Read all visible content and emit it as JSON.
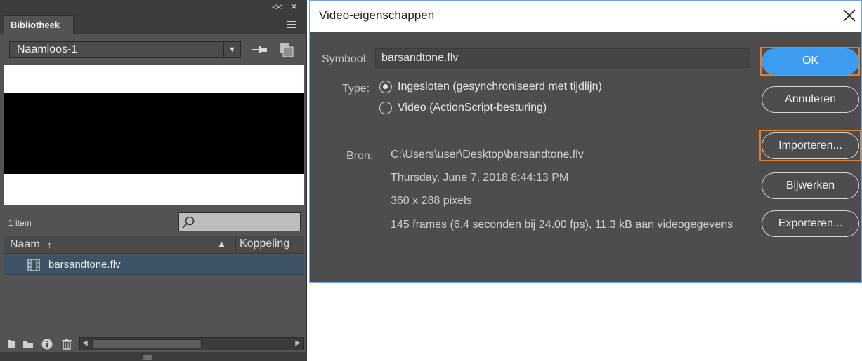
{
  "library": {
    "panel_controls": {
      "collapse": "<<",
      "close": "✕"
    },
    "tab_label": "Bibliotheek",
    "document_select": "Naamloos-1",
    "item_count": "1 item",
    "columns": {
      "name": "Naam",
      "linkage": "Koppeling"
    },
    "items": [
      {
        "name": "barsandtone.flv",
        "icon": "video-file-icon"
      }
    ],
    "preview_colors": {
      "background": "#ffffff",
      "band": "#000000"
    }
  },
  "dialog": {
    "title": "Video-eigenschappen",
    "symbol_label": "Symbool:",
    "symbol_value": "barsandtone.flv",
    "type_label": "Type:",
    "type_options": [
      {
        "label": "Ingesloten (gesynchroniseerd met tijdlijn)",
        "selected": true
      },
      {
        "label": "Video (ActionScript-besturing)",
        "selected": false
      }
    ],
    "source_label": "Bron:",
    "source_lines": [
      "C:\\Users\\user\\Desktop\\barsandtone.flv",
      "Thursday, June 7, 2018  8:44:13 PM",
      "360 x 288 pixels",
      "145 frames (6.4 seconden bij 24.00 fps), 11.3 kB aan videogegevens"
    ],
    "buttons": {
      "ok": "OK",
      "cancel": "Annuleren",
      "import": "Importeren...",
      "update": "Bijwerken",
      "export": "Exporteren..."
    },
    "colors": {
      "accent": "#3b9cf0",
      "highlight": "#e1812f"
    }
  }
}
